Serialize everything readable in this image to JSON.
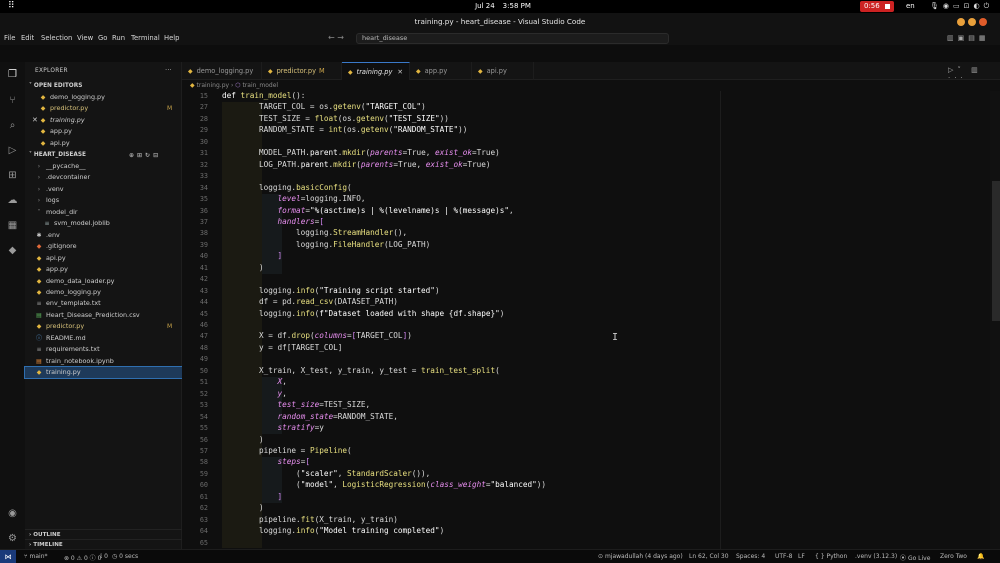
{
  "os": {
    "activities_icon": "grid-dots-icon",
    "date": "Jul 24",
    "time": "3:58 PM",
    "recording": "0:56",
    "lang": "en",
    "tray_icons": [
      "mic-icon",
      "network-icon",
      "volume-icon",
      "power-icon"
    ]
  },
  "window": {
    "title": "training.py - heart_disease - Visual Studio Code"
  },
  "menu": {
    "items": [
      "File",
      "Edit",
      "Selection",
      "View",
      "Go",
      "Run",
      "Terminal",
      "Help"
    ],
    "search": "heart_disease"
  },
  "sidebar": {
    "title": "EXPLORER",
    "open_editors_label": "OPEN EDITORS",
    "open_editors": [
      {
        "name": "demo_logging.py",
        "badge": ""
      },
      {
        "name": "predictor.py",
        "badge": "M"
      },
      {
        "name": "training.py",
        "badge": ""
      },
      {
        "name": "app.py",
        "badge": ""
      },
      {
        "name": "api.py",
        "badge": ""
      }
    ],
    "folder_label": "HEART_DISEASE",
    "tree": [
      {
        "name": "__pycache__",
        "kind": "folder"
      },
      {
        "name": ".devcontainer",
        "kind": "folder"
      },
      {
        "name": ".venv",
        "kind": "folder"
      },
      {
        "name": "logs",
        "kind": "folder"
      },
      {
        "name": "model_dir",
        "kind": "folder-open"
      },
      {
        "name": "svm_model.joblib",
        "kind": "file",
        "indent": true
      },
      {
        "name": ".env",
        "kind": "env"
      },
      {
        "name": ".gitignore",
        "kind": "git"
      },
      {
        "name": "api.py",
        "kind": "py"
      },
      {
        "name": "app.py",
        "kind": "py"
      },
      {
        "name": "demo_data_loader.py",
        "kind": "py"
      },
      {
        "name": "demo_logging.py",
        "kind": "py"
      },
      {
        "name": "env_template.txt",
        "kind": "txt"
      },
      {
        "name": "Heart_Disease_Prediction.csv",
        "kind": "csv"
      },
      {
        "name": "predictor.py",
        "kind": "py",
        "badge": "M"
      },
      {
        "name": "README.md",
        "kind": "md"
      },
      {
        "name": "requirements.txt",
        "kind": "txt"
      },
      {
        "name": "train_notebook.ipynb",
        "kind": "nb"
      },
      {
        "name": "training.py",
        "kind": "py",
        "selected": true
      }
    ],
    "outline_label": "OUTLINE",
    "timeline_label": "TIMELINE"
  },
  "tabs": [
    {
      "name": "demo_logging.py",
      "modified": ""
    },
    {
      "name": "predictor.py",
      "modified": "M"
    },
    {
      "name": "training.py",
      "modified": "",
      "active": true
    },
    {
      "name": "app.py",
      "modified": ""
    },
    {
      "name": "api.py",
      "modified": ""
    }
  ],
  "breadcrumb": [
    "training.py",
    "train_model"
  ],
  "code": {
    "line_numbers": [
      "15",
      "27",
      "28",
      "29",
      "30",
      "31",
      "32",
      "33",
      "34",
      "35",
      "36",
      "37",
      "38",
      "39",
      "40",
      "41",
      "42",
      "43",
      "44",
      "45",
      "46",
      "47",
      "48",
      "49",
      "50",
      "51",
      "52",
      "53",
      "54",
      "55",
      "56",
      "57",
      "58",
      "59",
      "60",
      "61",
      "62",
      "63",
      "64",
      "65"
    ]
  },
  "status": {
    "branch": "main*",
    "problems": "⊗ 0 ⚠ 0 ⓘ 0",
    "ports": "0",
    "time": "0 secs",
    "author": "mjawadullah (4 days ago)",
    "position": "Ln 62, Col 30",
    "spaces": "Spaces: 4",
    "encoding": "UTF-8",
    "eol": "LF",
    "lang": "{ } Python",
    "env": ".venv (3.12.3)",
    "live": "Go Live",
    "theme": "Zero Two",
    "bell": "bell-icon"
  }
}
